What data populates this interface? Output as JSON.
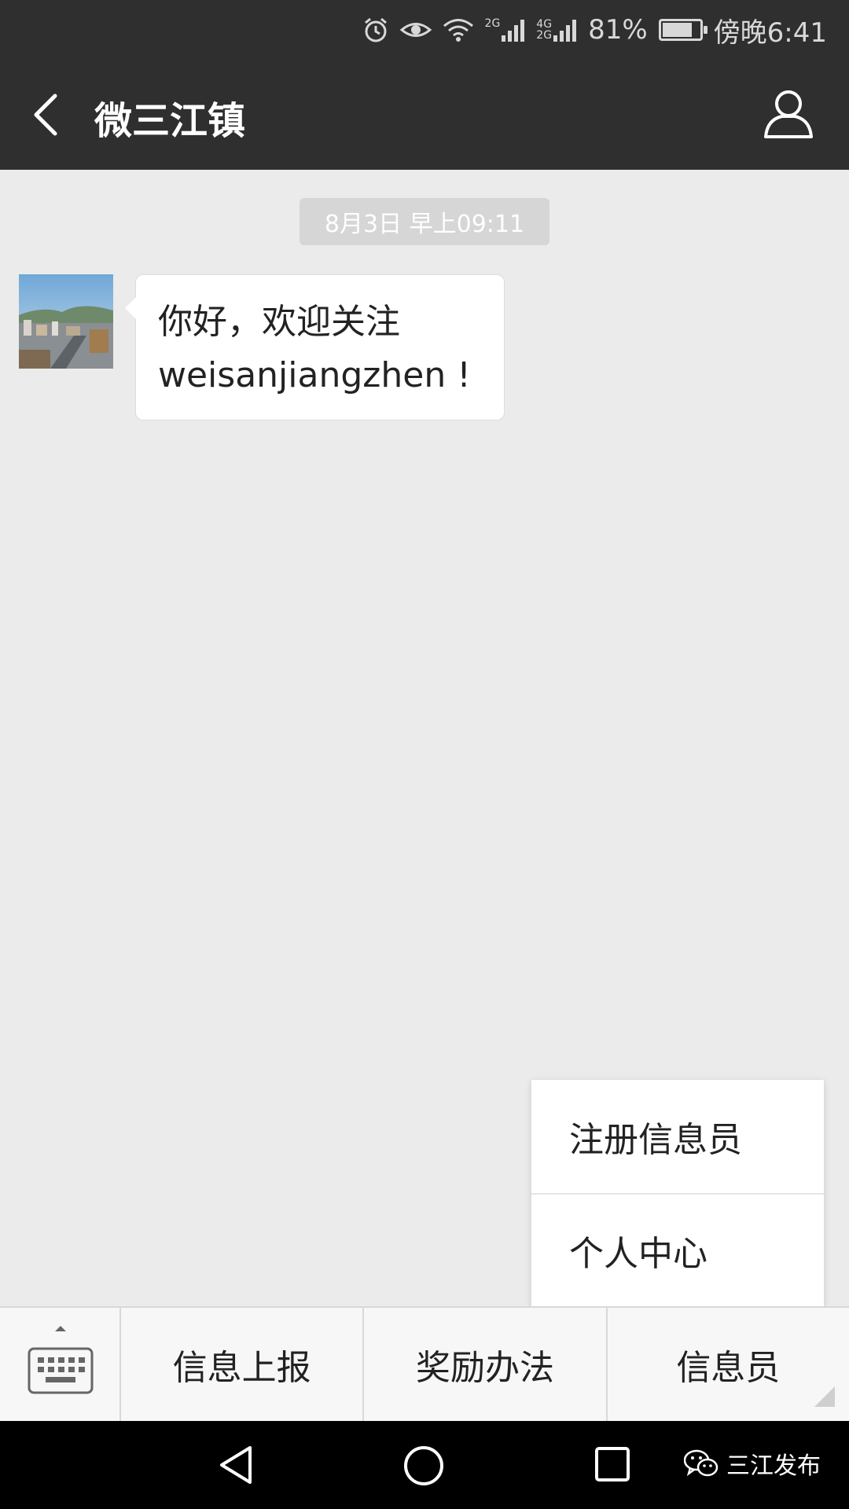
{
  "status_bar": {
    "battery_percent": "81%",
    "time": "傍晚6:41",
    "signal_1_tag": "2G",
    "signal_2_tag_top": "4G",
    "signal_2_tag_bottom": "2G",
    "icons": [
      "alarm-icon",
      "eye-icon",
      "wifi-icon",
      "signal-icon",
      "signal-icon",
      "battery-icon"
    ]
  },
  "header": {
    "title": "微三江镇",
    "back_icon": "chevron-left-icon",
    "profile_icon": "person-icon"
  },
  "chat": {
    "timestamp": "8月3日 早上09:11",
    "messages": [
      {
        "line1": "你好，欢迎关注",
        "line2": "weisanjiangzhen !"
      }
    ]
  },
  "popup_menu": {
    "items": [
      {
        "label": "注册信息员"
      },
      {
        "label": "个人中心"
      }
    ]
  },
  "bottom_menu": {
    "keyboard_icon": "keyboard-icon",
    "items": [
      {
        "label": "信息上报"
      },
      {
        "label": "奖励办法"
      },
      {
        "label": "信息员"
      }
    ]
  },
  "nav_bar": {
    "watermark": "三江发布"
  },
  "colors": {
    "header_bg": "#2f2f2f",
    "chat_bg": "#ebebeb",
    "bubble_bg": "#ffffff",
    "timestamp_bg": "#d6d6d6",
    "nav_bg": "#000000"
  }
}
